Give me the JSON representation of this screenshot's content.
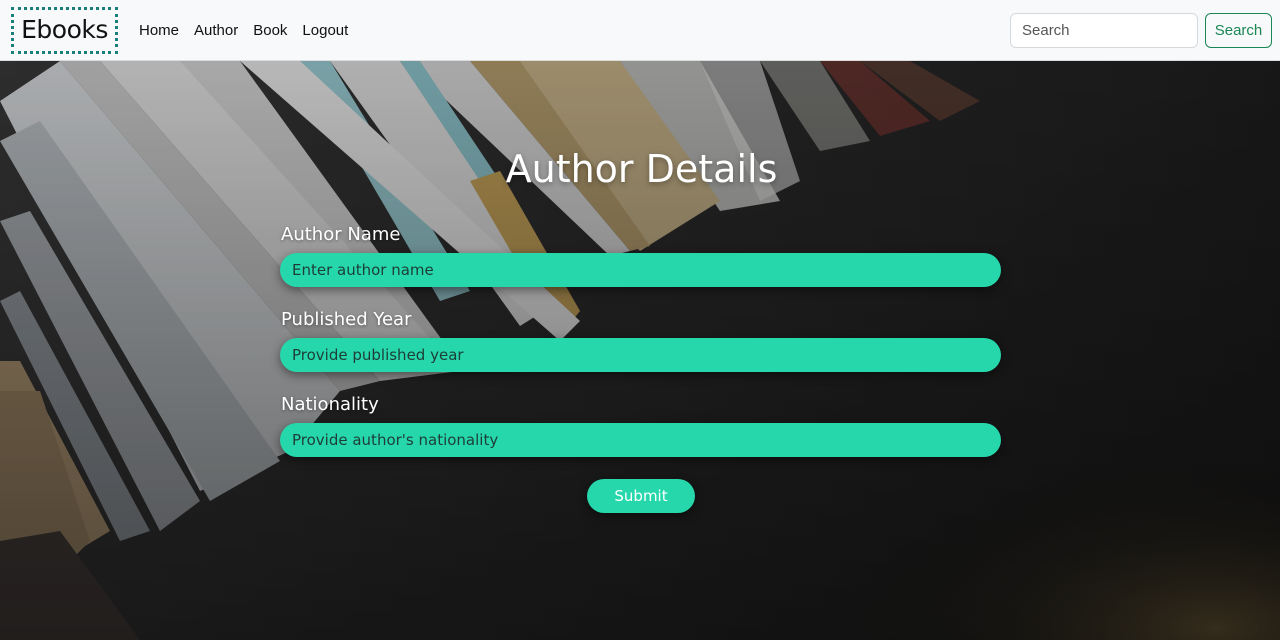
{
  "navbar": {
    "brand": "Ebooks",
    "links": [
      "Home",
      "Author",
      "Book",
      "Logout"
    ],
    "search_placeholder": "Search",
    "search_button": "Search"
  },
  "form": {
    "title": "Author Details",
    "fields": [
      {
        "label": "Author Name",
        "placeholder": "Enter author name"
      },
      {
        "label": "Published Year",
        "placeholder": "Provide published year"
      },
      {
        "label": "Nationality",
        "placeholder": "Provide author's nationality"
      }
    ],
    "submit_label": "Submit"
  },
  "colors": {
    "accent": "#27d7ac",
    "navbar_bg": "#f8f9fa",
    "search_button": "#198754",
    "brand_border": "#1a7f78"
  }
}
